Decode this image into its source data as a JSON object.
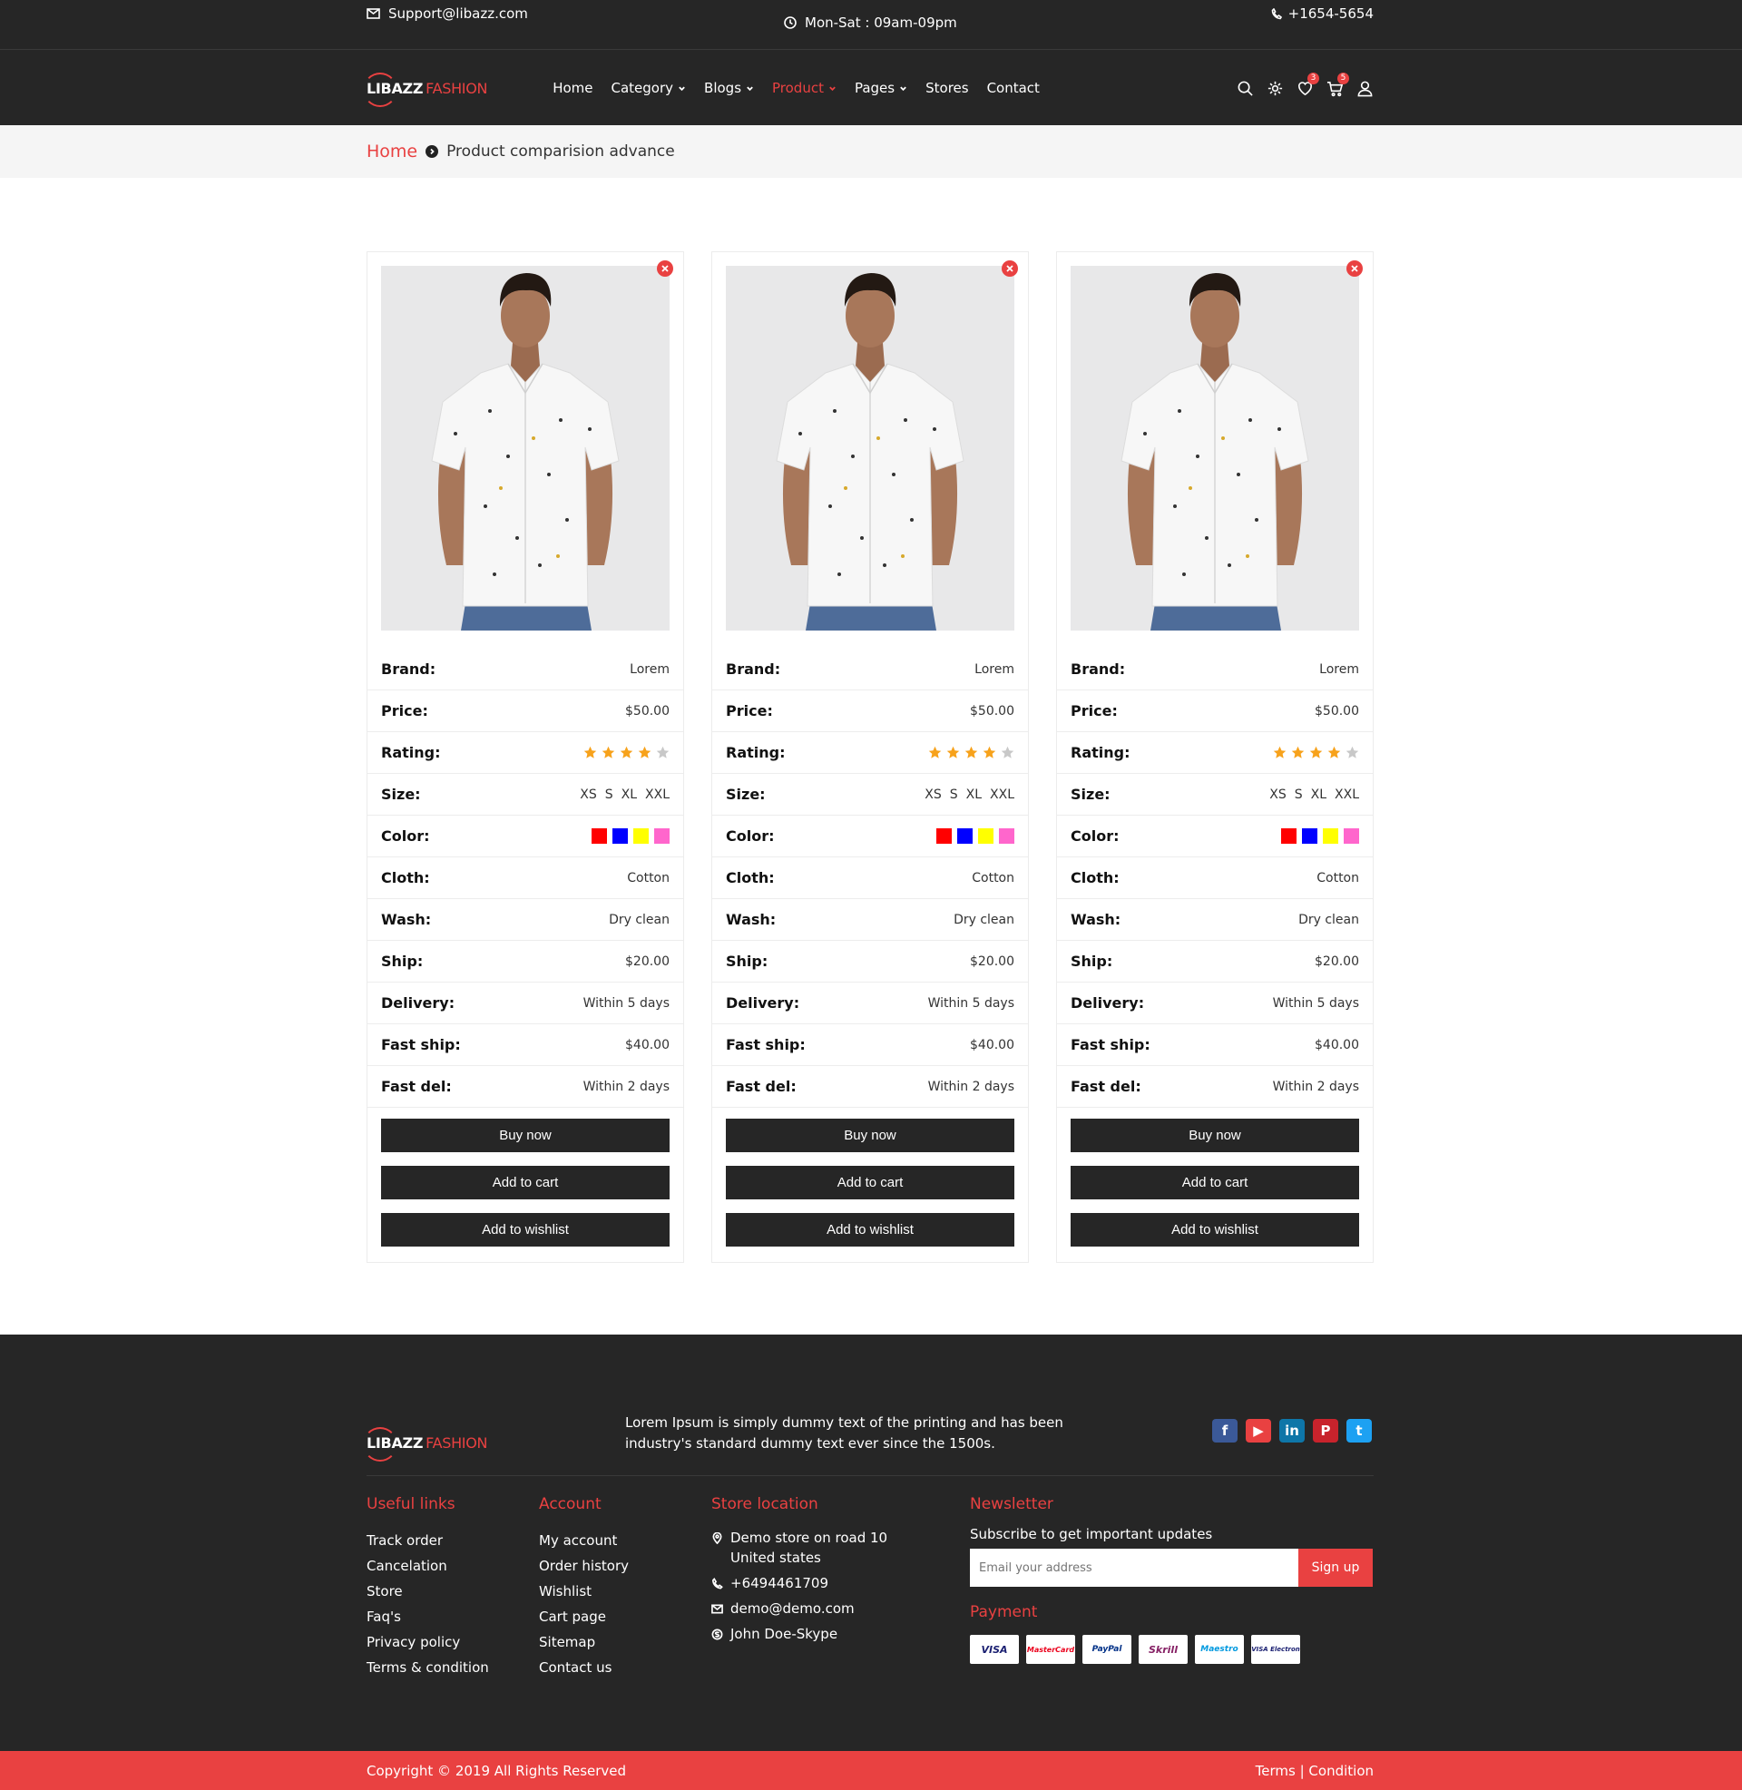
{
  "topbar": {
    "email": "Support@libazz.com",
    "hours": "Mon-Sat : 09am-09pm",
    "phone": "+1654-5654"
  },
  "brand": {
    "name_part1": "LIBAZZ",
    "name_part2": "FASHION"
  },
  "nav": {
    "items": [
      {
        "label": "Home",
        "dropdown": false
      },
      {
        "label": "Category",
        "dropdown": true
      },
      {
        "label": "Blogs",
        "dropdown": true
      },
      {
        "label": "Product",
        "dropdown": true,
        "active": true
      },
      {
        "label": "Pages",
        "dropdown": true
      },
      {
        "label": "Stores",
        "dropdown": false
      },
      {
        "label": "Contact",
        "dropdown": false
      }
    ],
    "wishlist_count": "3",
    "cart_count": "5"
  },
  "breadcrumb": {
    "home": "Home",
    "current": "Product comparision advance"
  },
  "comparison": {
    "labels": {
      "brand": "Brand:",
      "price": "Price:",
      "rating": "Rating:",
      "size": "Size:",
      "color": "Color:",
      "cloth": "Cloth:",
      "wash": "Wash:",
      "ship": "Ship:",
      "delivery": "Delivery:",
      "fast_ship": "Fast ship:",
      "fast_del": "Fast del:"
    },
    "buttons": {
      "buy": "Buy now",
      "cart": "Add to cart",
      "wishlist": "Add to wishlist"
    },
    "products": [
      {
        "brand": "Lorem",
        "price": "$50.00",
        "rating": 4,
        "rating_max": 5,
        "sizes": [
          "XS",
          "S",
          "XL",
          "XXL"
        ],
        "colors": [
          "#ff0000",
          "#0000ff",
          "#ffff00",
          "#ff66cc"
        ],
        "cloth": "Cotton",
        "wash": "Dry clean",
        "ship": "$20.00",
        "delivery": "Within 5 days",
        "fast_ship": "$40.00",
        "fast_del": "Within 2 days"
      },
      {
        "brand": "Lorem",
        "price": "$50.00",
        "rating": 4,
        "rating_max": 5,
        "sizes": [
          "XS",
          "S",
          "XL",
          "XXL"
        ],
        "colors": [
          "#ff0000",
          "#0000ff",
          "#ffff00",
          "#ff66cc"
        ],
        "cloth": "Cotton",
        "wash": "Dry clean",
        "ship": "$20.00",
        "delivery": "Within 5 days",
        "fast_ship": "$40.00",
        "fast_del": "Within 2 days"
      },
      {
        "brand": "Lorem",
        "price": "$50.00",
        "rating": 4,
        "rating_max": 5,
        "sizes": [
          "XS",
          "S",
          "XL",
          "XXL"
        ],
        "colors": [
          "#ff0000",
          "#0000ff",
          "#ffff00",
          "#ff66cc"
        ],
        "cloth": "Cotton",
        "wash": "Dry clean",
        "ship": "$20.00",
        "delivery": "Within 5 days",
        "fast_ship": "$40.00",
        "fast_del": "Within 2 days"
      }
    ]
  },
  "footer": {
    "about": "Lorem Ipsum is simply dummy text of the printing and has been industry's standard dummy text ever since the 1500s.",
    "socials": [
      "facebook-icon",
      "youtube-icon",
      "linkedin-icon",
      "pinterest-icon",
      "twitter-icon"
    ],
    "useful_links": {
      "title": "Useful links",
      "items": [
        "Track order",
        "Cancelation",
        "Store",
        "Faq's",
        "Privacy policy",
        "Terms & condition"
      ]
    },
    "account": {
      "title": "Account",
      "items": [
        "My account",
        "Order history",
        "Wishlist",
        "Cart page",
        "Sitemap",
        "Contact us"
      ]
    },
    "store": {
      "title": "Store location",
      "address_line1": "Demo store on road 10",
      "address_line2": "United states",
      "phone": "+6494461709",
      "email": "demo@demo.com",
      "skype": "John Doe-Skype"
    },
    "newsletter": {
      "title": "Newsletter",
      "subtitle": "Subscribe to get important updates",
      "placeholder": "Email your address",
      "button": "Sign up"
    },
    "payment": {
      "title": "Payment",
      "methods": [
        "VISA",
        "MasterCard",
        "PayPal",
        "Skrill",
        "Maestro",
        "VISA Electron"
      ]
    },
    "copyright": "Copyright © 2019 All Rights Reserved",
    "terms": "Terms | Condition"
  },
  "colors": {
    "accent": "#e94141",
    "dark": "#262626",
    "star": "#f7a21b",
    "star_empty": "#c8c8c8"
  }
}
